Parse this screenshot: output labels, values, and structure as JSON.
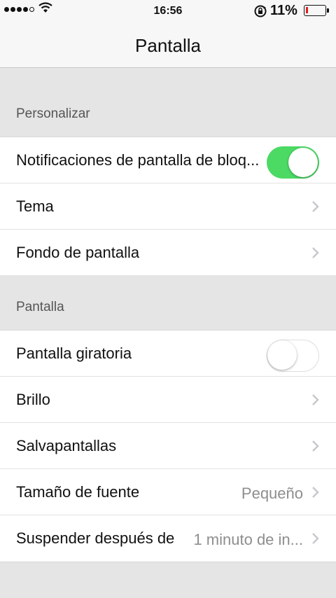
{
  "status_bar": {
    "time": "16:56",
    "battery_percent": "11%",
    "battery_level": 0.11,
    "battery_color": "#e02020"
  },
  "nav": {
    "title": "Pantalla"
  },
  "sections": [
    {
      "header": "Personalizar",
      "rows": [
        {
          "label": "Notificaciones de pantalla de bloq...",
          "control": "toggle",
          "toggle_on": true
        },
        {
          "label": "Tema",
          "control": "chevron"
        },
        {
          "label": "Fondo de pantalla",
          "control": "chevron"
        }
      ]
    },
    {
      "header": "Pantalla",
      "rows": [
        {
          "label": "Pantalla giratoria",
          "control": "toggle",
          "toggle_on": false
        },
        {
          "label": "Brillo",
          "control": "chevron"
        },
        {
          "label": "Salvapantallas",
          "control": "chevron"
        },
        {
          "label": "Tamaño de fuente",
          "value": "Pequeño",
          "control": "chevron"
        },
        {
          "label": "Suspender después de",
          "value": "1 minuto de in...",
          "control": "chevron"
        }
      ]
    }
  ],
  "colors": {
    "toggle_on": "#4cd964",
    "accent_text": "#8e8e8e"
  }
}
